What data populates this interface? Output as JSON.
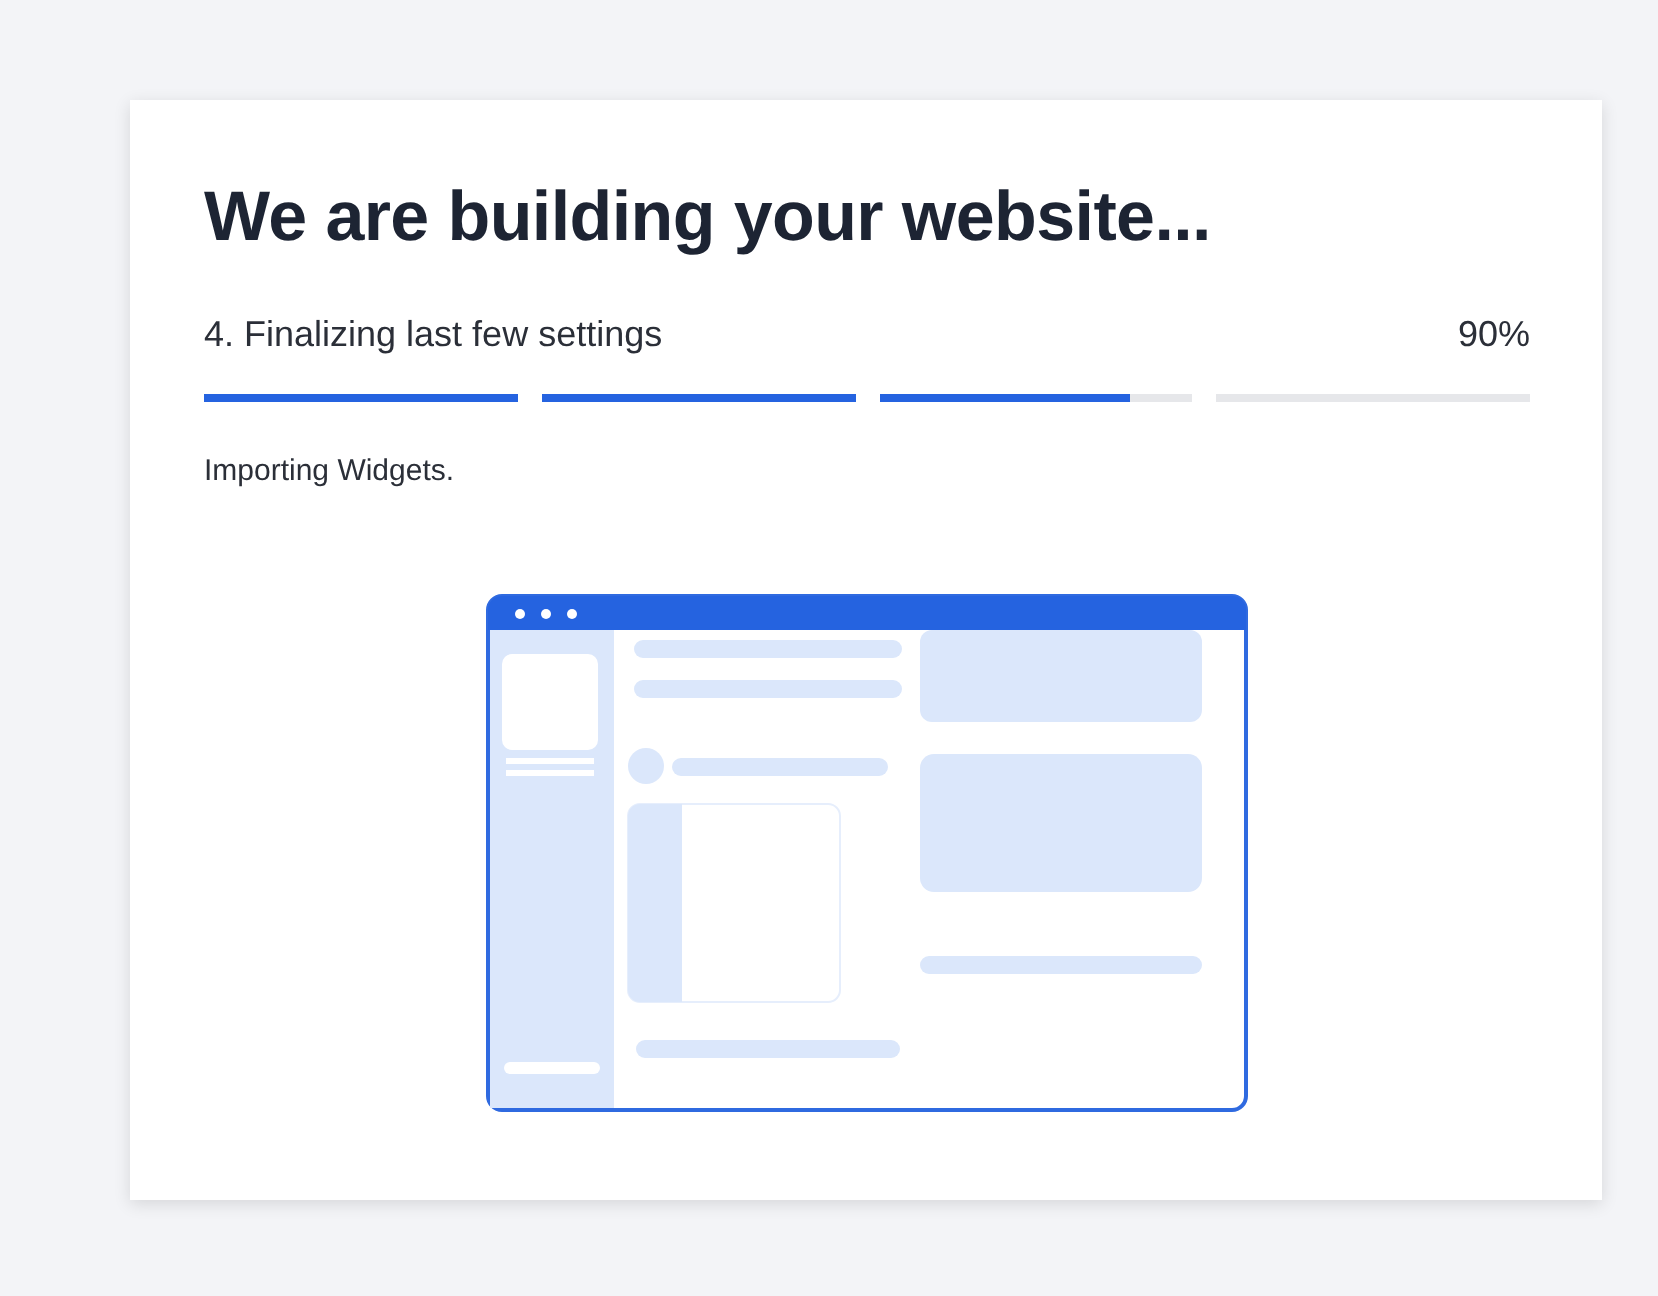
{
  "title": "We are building your website...",
  "step": {
    "label": "4. Finalizing last few settings",
    "percent": "90%"
  },
  "segments": [
    {
      "level": 1
    },
    {
      "level": 1
    },
    {
      "level": 0.8
    },
    {
      "level": 0
    }
  ],
  "status": "Importing Widgets."
}
